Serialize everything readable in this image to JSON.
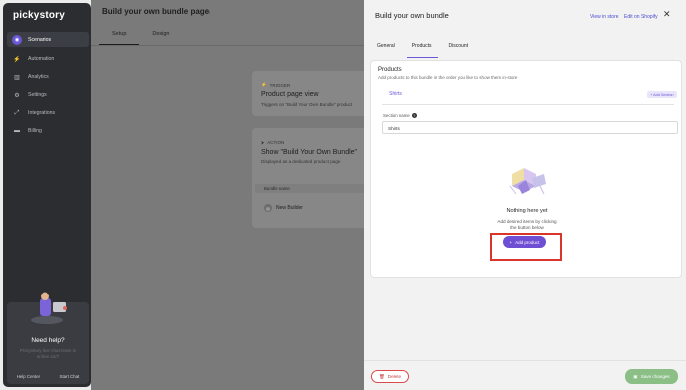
{
  "sidebar": {
    "logo": "pickystory",
    "items": [
      {
        "label": "Scenarios",
        "icon": "scenarios-icon",
        "active": true
      },
      {
        "label": "Automation",
        "icon": "lightning-icon"
      },
      {
        "label": "Analytics",
        "icon": "chart-icon"
      },
      {
        "label": "Settings",
        "icon": "gear-icon"
      },
      {
        "label": "Integrations",
        "icon": "integrations-icon"
      },
      {
        "label": "Billing",
        "icon": "billing-icon"
      }
    ],
    "help": {
      "title": "Need help?",
      "text": "PickyStory live chat team is online 24/7",
      "help_center": "Help Center",
      "start_chat": "Start Chat"
    }
  },
  "page": {
    "title": "Build your own bundle page",
    "tabs": [
      "Setup",
      "Design"
    ]
  },
  "trigger_card": {
    "label": "TRIGGER",
    "title": "Product page view",
    "subtitle": "Triggers on \"Build Your Own Bundle\" product"
  },
  "action_card": {
    "label": "ACTION",
    "title": "Show \"Build Your Own Bundle\"",
    "subtitle": "Displayed as a dedicated product page",
    "column_header": "Bundle name",
    "row_name": "New Builder"
  },
  "panel": {
    "title": "Build your own bundle",
    "view_in_store": "View in store",
    "edit_on_shopify": "Edit on Shopify",
    "tabs": [
      "General",
      "Products",
      "Discount"
    ],
    "products": {
      "title": "Products",
      "subtitle": "Add products to this bundle in the order you like to show them in-store",
      "section_tab": "Shirts",
      "add_section": "+ Add Section",
      "section_name_label": "Section name",
      "section_name_value": "Shirts",
      "empty_title": "Nothing here yet",
      "empty_text": "Add desired items by clicking the button below",
      "add_product": "Add product"
    },
    "delete": "Delete",
    "save": "Save changes"
  },
  "colors": {
    "accent": "#6e4fd4",
    "highlight": "#d9352b",
    "save": "#8bbf86",
    "danger": "#c43b3b"
  }
}
